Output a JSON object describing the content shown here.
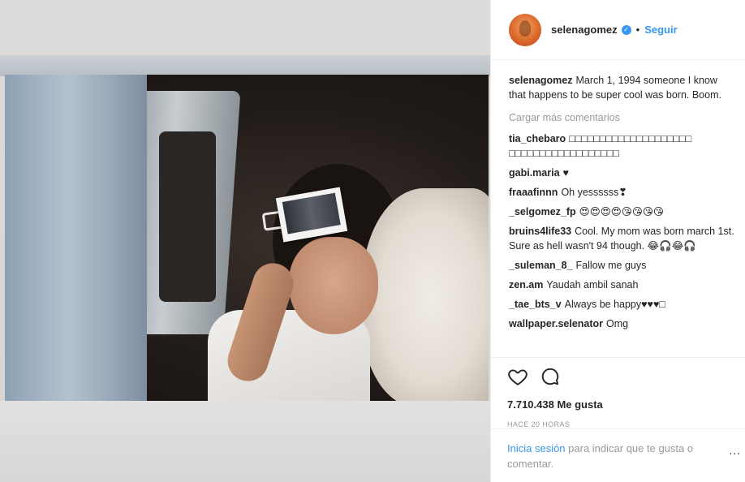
{
  "post": {
    "username": "selenagomez",
    "follow_label": "Seguir",
    "dot": "•",
    "caption": "March 1, 1994 someone I know that happens to be super cool was born. Boom.",
    "load_more": "Cargar más comentarios",
    "comments": [
      {
        "user": "tia_chebaro",
        "text": "□□□□□□□□□□□□□□□□□□□□ □□□□□□□□□□□□□□□□□□"
      },
      {
        "user": "gabi.maria",
        "text": "♥"
      },
      {
        "user": "fraaafinnn",
        "text": "Oh yessssss❣"
      },
      {
        "user": "_selgomez_fp",
        "text": "😍😍😍😍😘😘😘😘"
      },
      {
        "user": "bruins4life33",
        "text": "Cool. My mom was born march 1st. Sure as hell wasn't 94 though. 😂🎧😂🎧"
      },
      {
        "user": "_suleman_8_",
        "text": "Fallow me guys"
      },
      {
        "user": "zen.am",
        "text": "Yaudah ambil sanah"
      },
      {
        "user": "_tae_bts_v",
        "text": "Always be happy♥♥♥□"
      },
      {
        "user": "wallpaper.selenator",
        "text": "Omg"
      }
    ],
    "likes": "7.710.438 Me gusta",
    "time": "HACE 20 HORAS",
    "login_link": "Inicia sesión",
    "login_text": " para indicar que te gusta o comentar.",
    "more_label": "..."
  },
  "colors": {
    "link": "#3897f0",
    "text": "#262626",
    "muted": "#999999"
  },
  "icons": [
    "heart-icon",
    "comment-icon",
    "verified-badge-icon",
    "more-options-icon"
  ]
}
